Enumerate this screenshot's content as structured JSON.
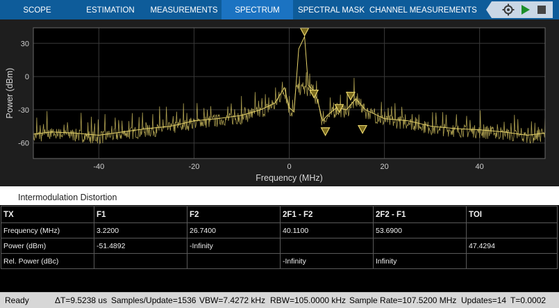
{
  "toolstrip": {
    "tabs": [
      {
        "label": "SCOPE",
        "active": false
      },
      {
        "label": "ESTIMATION",
        "active": false
      },
      {
        "label": "MEASUREMENTS",
        "active": false
      },
      {
        "label": "SPECTRUM",
        "active": true
      },
      {
        "label": "SPECTRAL MASK",
        "active": false
      },
      {
        "label": "CHANNEL MEASUREMENTS",
        "active": false
      }
    ],
    "tools": [
      "settings-icon",
      "run-icon",
      "stop-icon"
    ],
    "colors": {
      "bar": "#0e5c9a",
      "active_tab": "#1b73c2",
      "tool_panel": "#c9d7e6"
    }
  },
  "chart_data": {
    "type": "line",
    "xlabel": "Frequency (MHz)",
    "ylabel": "Power (dBm)",
    "xlim": [
      -53.76,
      53.76
    ],
    "ylim": [
      -74,
      44
    ],
    "xticks": [
      -40,
      -20,
      0,
      20,
      40
    ],
    "yticks": [
      30,
      0,
      -30,
      -60
    ],
    "grid": true,
    "background": "#000000",
    "series_color": "#e6d36a",
    "series": [
      {
        "x": [
          -53.7,
          -50,
          -45,
          -40,
          -35,
          -30,
          -25,
          -20,
          -15,
          -10,
          -6,
          -3,
          -1,
          0,
          1,
          2,
          3.22,
          4,
          5,
          6,
          7,
          8,
          10,
          12,
          14,
          16,
          20,
          25,
          30,
          35,
          40,
          45,
          50,
          53.7
        ],
        "y": [
          -52,
          -50,
          -51,
          -53,
          -50,
          -47,
          -45,
          -40,
          -38,
          -35,
          -30,
          -24,
          -10,
          -28,
          -32,
          25,
          36,
          -8,
          -12,
          -22,
          -40,
          -35,
          -28,
          -30,
          -20,
          -30,
          -38,
          -40,
          -45,
          -47,
          -48,
          -50,
          -53,
          -51
        ]
      }
    ],
    "markers": [
      {
        "x": 3.22,
        "y": 40
      },
      {
        "x": 5.2,
        "y": -16
      },
      {
        "x": 7.6,
        "y": -50
      },
      {
        "x": 10.5,
        "y": -29
      },
      {
        "x": 12.9,
        "y": -18
      },
      {
        "x": 15.4,
        "y": -48
      }
    ]
  },
  "measurements": {
    "title": "Intermodulation Distortion",
    "headers": [
      "TX",
      "F1",
      "F2",
      "2F1 - F2",
      "2F2 - F1",
      "TOI"
    ],
    "rows": [
      [
        "Frequency (MHz)",
        "3.2200",
        "26.7400",
        "40.1100",
        "53.6900",
        ""
      ],
      [
        "Power (dBm)",
        "-51.4892",
        "-Infinity",
        "",
        "",
        "47.4294"
      ],
      [
        "Rel. Power (dBc)",
        "",
        "",
        "-Infinity",
        "Infinity",
        ""
      ]
    ]
  },
  "status": {
    "state": "Ready",
    "delta_t": "ΔT=9.5238 us",
    "samples": "Samples/Update=1536",
    "vbw": "VBW=7.4272 kHz",
    "rbw": "RBW=105.0000 kHz",
    "sample_rate": "Sample Rate=107.5200 MHz",
    "updates": "Updates=14",
    "time": "T=0.0002"
  }
}
